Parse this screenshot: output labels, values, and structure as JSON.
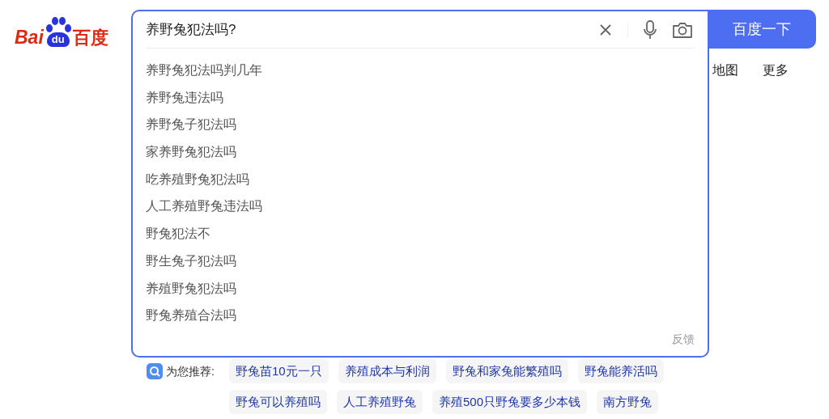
{
  "logo": {
    "text_latin": "Bai",
    "text_badge": "du",
    "text_cn": "百度"
  },
  "search": {
    "value": "养野兔犯法吗?",
    "button": "百度一下"
  },
  "nav": [
    "地图",
    "更多"
  ],
  "suggestions": [
    "养野兔犯法吗判几年",
    "养野兔违法吗",
    "养野兔子犯法吗",
    "家养野兔犯法吗",
    "吃养殖野兔犯法吗",
    "人工养殖野兔违法吗",
    "野兔犯法不",
    "野生兔子犯法吗",
    "养殖野兔犯法吗",
    "野兔养殖合法吗"
  ],
  "feedback": "反馈",
  "recommend": {
    "label": "为您推荐:",
    "chips": [
      [
        "野兔苗10元一只",
        "养殖成本与利润",
        "野兔和家兔能繁殖吗",
        "野兔能养活吗"
      ],
      [
        "野兔可以养殖吗",
        "人工养殖野兔",
        "养殖500只野兔要多少本钱",
        "南方野兔"
      ]
    ]
  }
}
